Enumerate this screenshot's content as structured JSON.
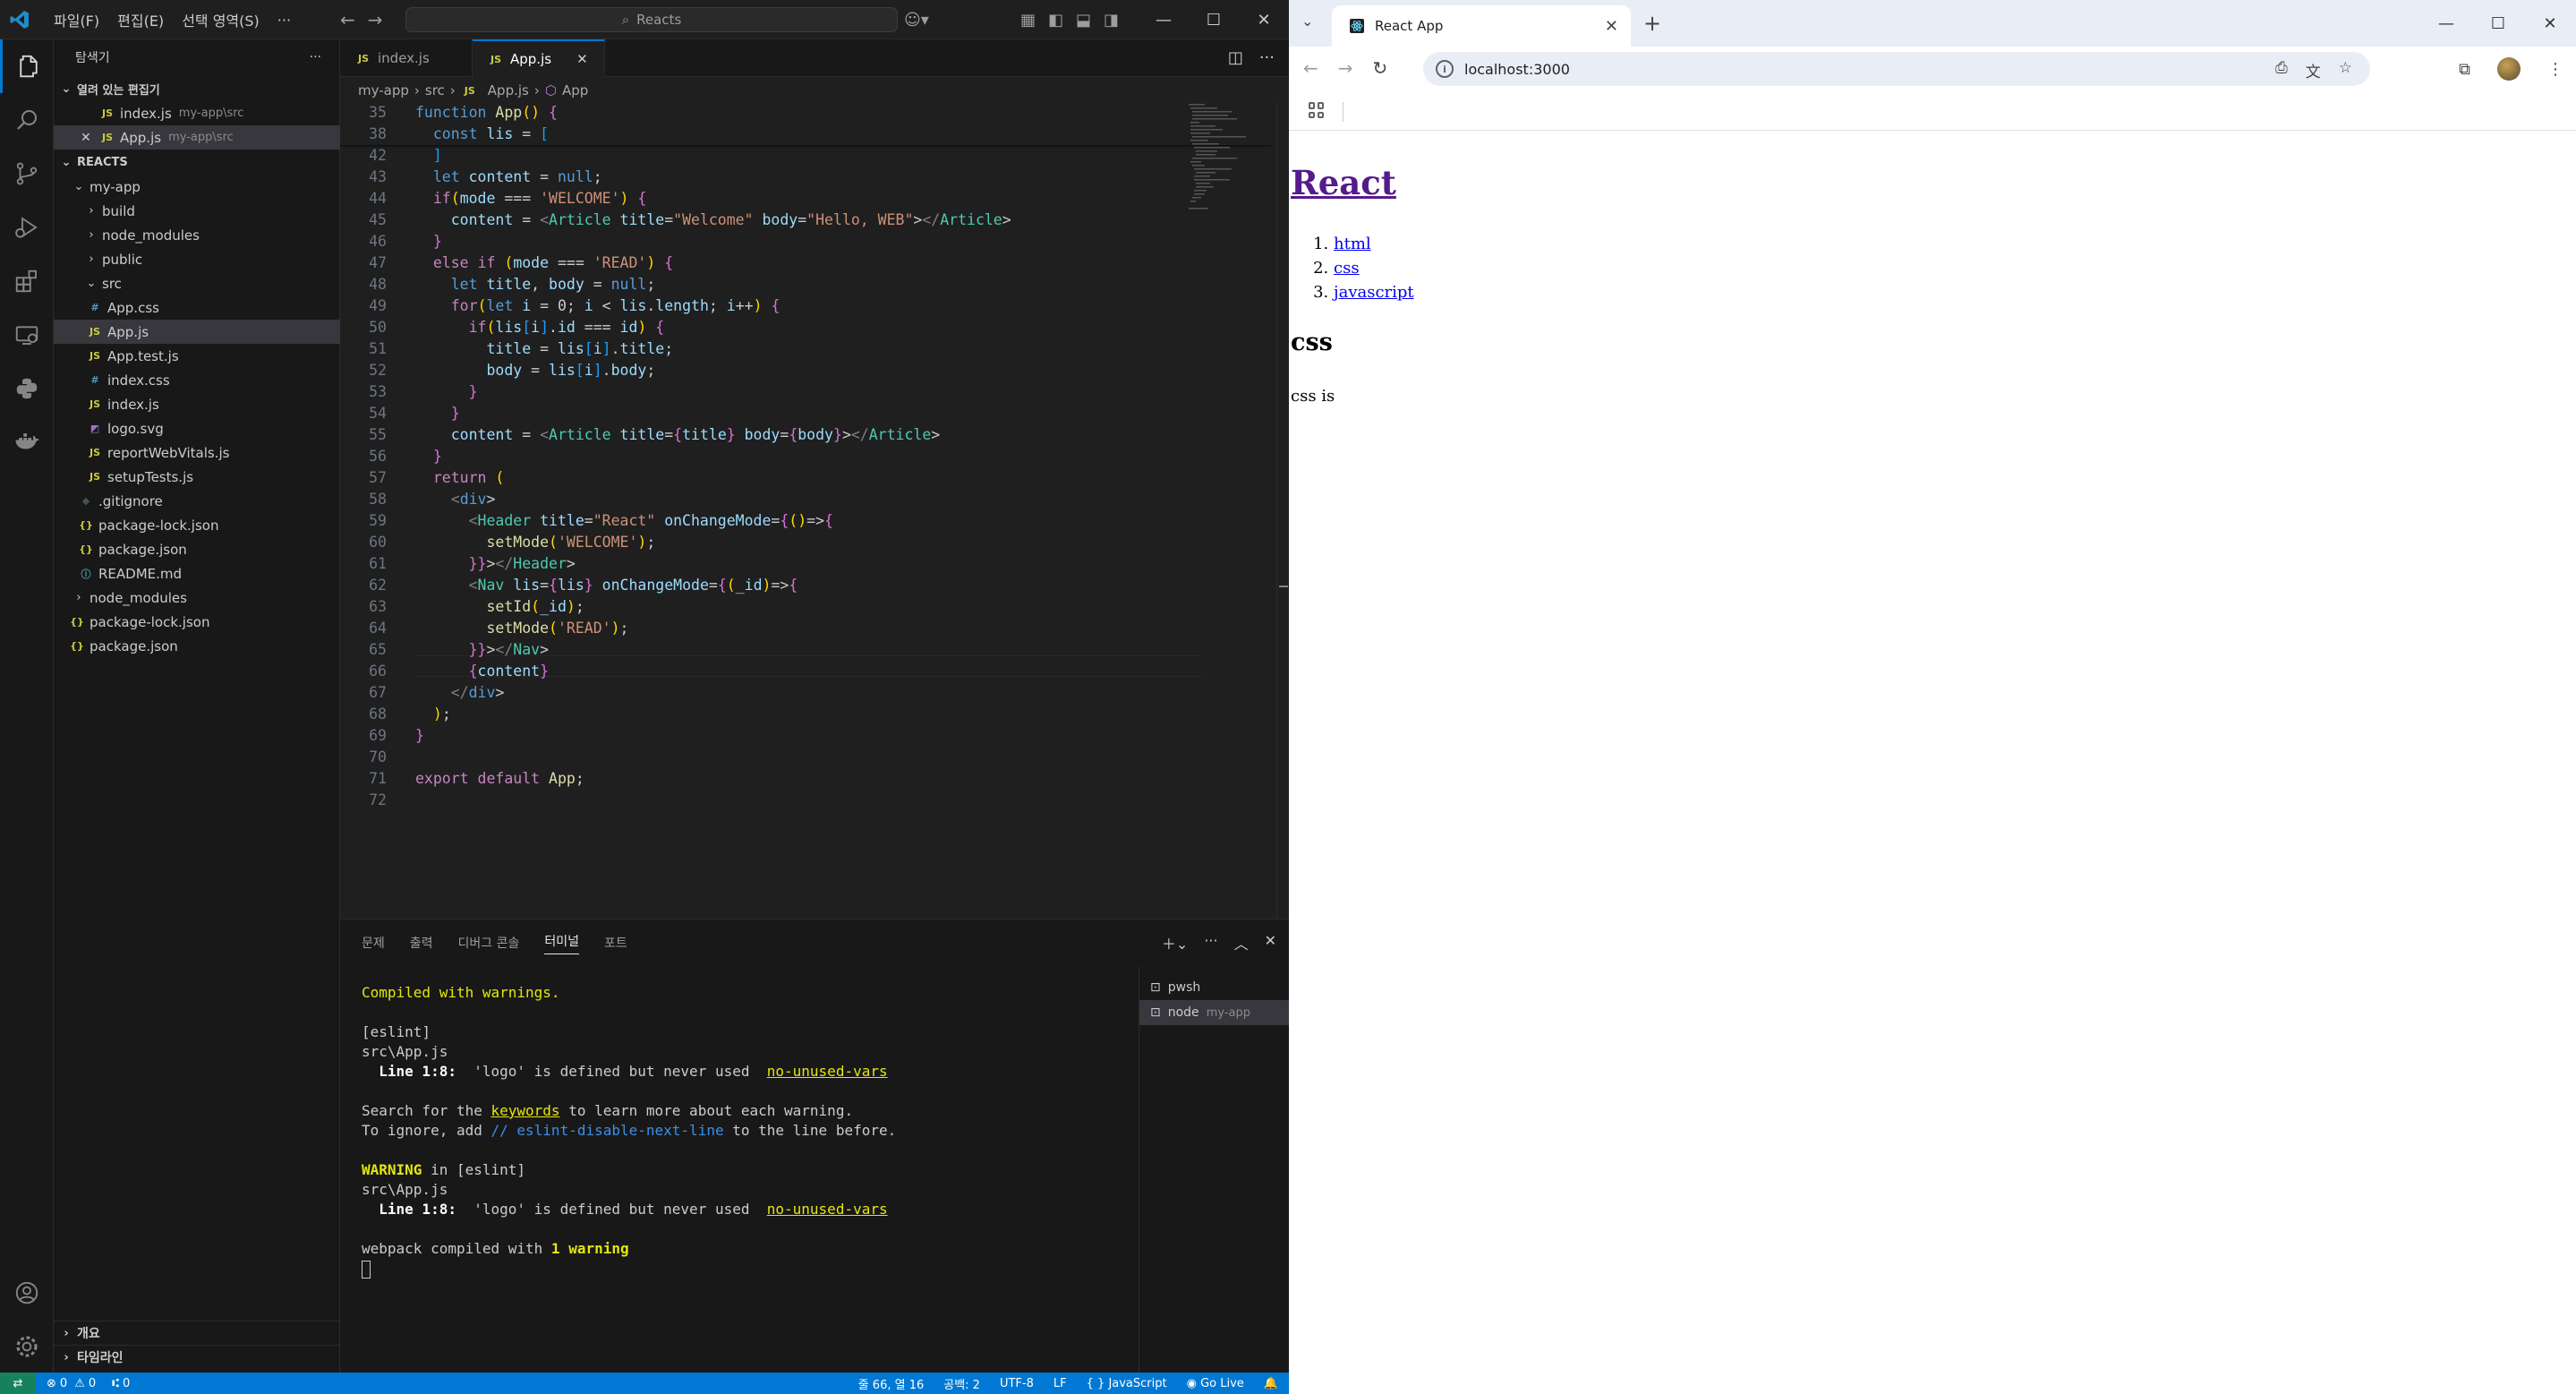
{
  "vscode": {
    "menu": [
      "파일(F)",
      "편집(E)",
      "선택 영역(S)",
      "···"
    ],
    "command_center": "Reacts",
    "sidebar": {
      "title": "탐색기",
      "open_editors_label": "열려 있는 편집기",
      "open_editors": [
        {
          "name": "index.js",
          "path": "my-app\\src"
        },
        {
          "name": "App.js",
          "path": "my-app\\src"
        }
      ],
      "workspace_label": "REACTS",
      "tree": [
        {
          "name": "my-app",
          "type": "folder",
          "open": true
        },
        {
          "name": "build",
          "type": "folder"
        },
        {
          "name": "node_modules",
          "type": "folder"
        },
        {
          "name": "public",
          "type": "folder"
        },
        {
          "name": "src",
          "type": "folder",
          "open": true
        },
        {
          "name": "App.css",
          "type": "css"
        },
        {
          "name": "App.js",
          "type": "js"
        },
        {
          "name": "App.test.js",
          "type": "js"
        },
        {
          "name": "index.css",
          "type": "css"
        },
        {
          "name": "index.js",
          "type": "js"
        },
        {
          "name": "logo.svg",
          "type": "svg"
        },
        {
          "name": "reportWebVitals.js",
          "type": "js"
        },
        {
          "name": "setupTests.js",
          "type": "js"
        },
        {
          "name": ".gitignore",
          "type": "git"
        },
        {
          "name": "package-lock.json",
          "type": "json"
        },
        {
          "name": "package.json",
          "type": "json"
        },
        {
          "name": "README.md",
          "type": "md"
        },
        {
          "name": "node_modules",
          "type": "folder"
        },
        {
          "name": "package-lock.json",
          "type": "json"
        },
        {
          "name": "package.json",
          "type": "json"
        }
      ],
      "outline_label": "개요",
      "timeline_label": "타임라인"
    },
    "tabs": [
      {
        "name": "index.js",
        "active": false
      },
      {
        "name": "App.js",
        "active": true
      }
    ],
    "breadcrumb": [
      "my-app",
      "src",
      "App.js",
      "App"
    ],
    "code_lines": [
      {
        "n": "35",
        "t": "function App() {"
      },
      {
        "n": "38",
        "t": "  const lis = ["
      },
      {
        "n": "42",
        "t": "  ]"
      },
      {
        "n": "43",
        "t": "  let content = null;"
      },
      {
        "n": "44",
        "t": "  if(mode === 'WELCOME') {"
      },
      {
        "n": "45",
        "t": "    content = <Article title=\"Welcome\" body=\"Hello, WEB\"></Article>"
      },
      {
        "n": "46",
        "t": "  }"
      },
      {
        "n": "47",
        "t": "  else if (mode === 'READ') {"
      },
      {
        "n": "48",
        "t": "    let title, body = null;"
      },
      {
        "n": "49",
        "t": "    for(let i = 0; i < lis.length; i++) {"
      },
      {
        "n": "50",
        "t": "      if(lis[i].id === id) {"
      },
      {
        "n": "51",
        "t": "        title = lis[i].title;"
      },
      {
        "n": "52",
        "t": "        body = lis[i].body;"
      },
      {
        "n": "53",
        "t": "      }"
      },
      {
        "n": "54",
        "t": "    }"
      },
      {
        "n": "55",
        "t": "    content = <Article title={title} body={body}></Article>"
      },
      {
        "n": "56",
        "t": "  }"
      },
      {
        "n": "57",
        "t": "  return ("
      },
      {
        "n": "58",
        "t": "    <div>"
      },
      {
        "n": "59",
        "t": "      <Header title=\"React\" onChangeMode={()=>{"
      },
      {
        "n": "60",
        "t": "        setMode('WELCOME');"
      },
      {
        "n": "61",
        "t": "      }}></Header>"
      },
      {
        "n": "62",
        "t": "      <Nav lis={lis} onChangeMode={(_id)=>{"
      },
      {
        "n": "63",
        "t": "        setId(_id);"
      },
      {
        "n": "64",
        "t": "        setMode('READ');"
      },
      {
        "n": "65",
        "t": "      }}></Nav>"
      },
      {
        "n": "66",
        "t": "      {content}"
      },
      {
        "n": "67",
        "t": "    </div>"
      },
      {
        "n": "68",
        "t": "  );"
      },
      {
        "n": "69",
        "t": "}"
      },
      {
        "n": "70",
        "t": ""
      },
      {
        "n": "71",
        "t": "export default App;"
      },
      {
        "n": "72",
        "t": ""
      }
    ],
    "panel_tabs": [
      "문제",
      "출력",
      "디버그 콘솔",
      "터미널",
      "포트"
    ],
    "active_panel_tab": "터미널",
    "terminal": {
      "compiled": "Compiled with warnings.",
      "eslint": "[eslint]",
      "file": "src\\App.js",
      "line_label": "Line 1:8:",
      "warning_msg": "'logo' is defined but never used",
      "rule": "no-unused-vars",
      "search_pre": "Search for the ",
      "keywords": "keywords",
      "search_post": " to learn more about each warning.",
      "ignore_pre": "To ignore, add ",
      "ignore_code": "// eslint-disable-next-line",
      "ignore_post": " to the line before.",
      "warning_word": "WARNING",
      "warning_in": " in [eslint]",
      "webpack_pre": "webpack compiled with ",
      "webpack_bold": "1 warning"
    },
    "terminal_list": [
      {
        "name": "pwsh",
        "sub": ""
      },
      {
        "name": "node",
        "sub": "my-app"
      }
    ],
    "status": {
      "errors": "0",
      "warnings": "0",
      "ports": "0",
      "position": "줄 66, 열 16",
      "spaces": "공백: 2",
      "encoding": "UTF-8",
      "eol": "LF",
      "language": "JavaScript",
      "golive": "Go Live"
    }
  },
  "browser": {
    "tab_title": "React App",
    "url": "localhost:3000",
    "page": {
      "heading": "React",
      "list": [
        "html",
        "css",
        "javascript"
      ],
      "subheading": "css",
      "body": "css is"
    }
  },
  "colors": {
    "accent": "#0078d4",
    "editor_bg": "#1f1f1f",
    "sidebar_bg": "#181818",
    "status_bg": "#0078d4",
    "visited_link": "#551a8b",
    "link": "#0000ee"
  }
}
